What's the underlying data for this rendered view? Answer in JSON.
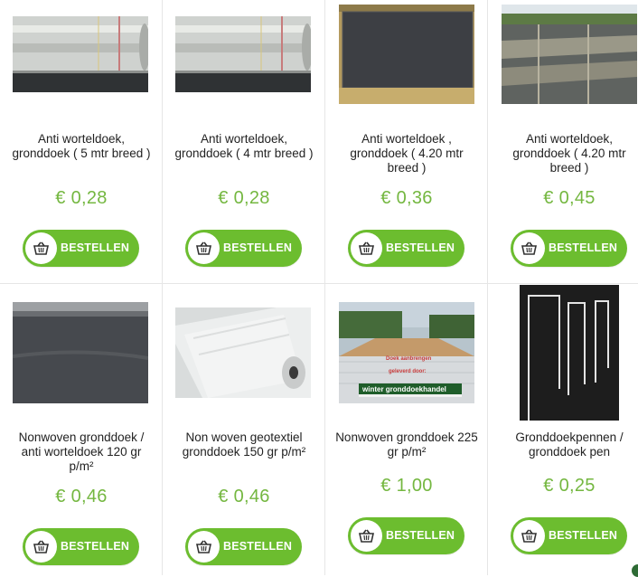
{
  "products": [
    {
      "title": "Anti worteldoek, gronddoek ( 5 mtr breed )",
      "price": "€ 0,28",
      "button": "BESTELLEN",
      "image_icon": "rolled-fabric-photo"
    },
    {
      "title": "Anti worteldoek, gronddoek ( 4 mtr breed )",
      "price": "€ 0,28",
      "button": "BESTELLEN",
      "image_icon": "rolled-fabric-photo"
    },
    {
      "title": "Anti worteldoek , gronddoek ( 4.20 mtr breed )",
      "price": "€ 0,36",
      "button": "BESTELLEN",
      "image_icon": "ground-cloth-photo"
    },
    {
      "title": "Anti worteldoek, gronddoek ( 4.20 mtr breed )",
      "price": "€ 0,45",
      "button": "BESTELLEN",
      "image_icon": "field-cloth-photo"
    },
    {
      "title": "Nonwoven gronddoek / anti worteldoek 120 gr p/m²",
      "price": "€ 0,46",
      "button": "BESTELLEN",
      "image_icon": "nonwoven-sheet-photo"
    },
    {
      "title": "Non woven geotextiel gronddoek 150 gr p/m²",
      "price": "€ 0,46",
      "button": "BESTELLEN",
      "image_icon": "geotextile-roll-photo"
    },
    {
      "title": "Nonwoven gronddoek 225 gr p/m²",
      "price": "€ 1,00",
      "button": "BESTELLEN",
      "image_icon": "site-photo",
      "photo_texts": [
        "Doek aanbrengen",
        "geleverd door:",
        "winter gronddoekhandel"
      ]
    },
    {
      "title": "Gronddoekpennen / gronddoek pen",
      "price": "€ 0,25",
      "button": "BESTELLEN",
      "image_icon": "ground-pins-photo"
    }
  ],
  "colors": {
    "accent": "#6cbd2f",
    "price": "#74b740"
  },
  "icons": {
    "button_icon": "basket-icon"
  }
}
